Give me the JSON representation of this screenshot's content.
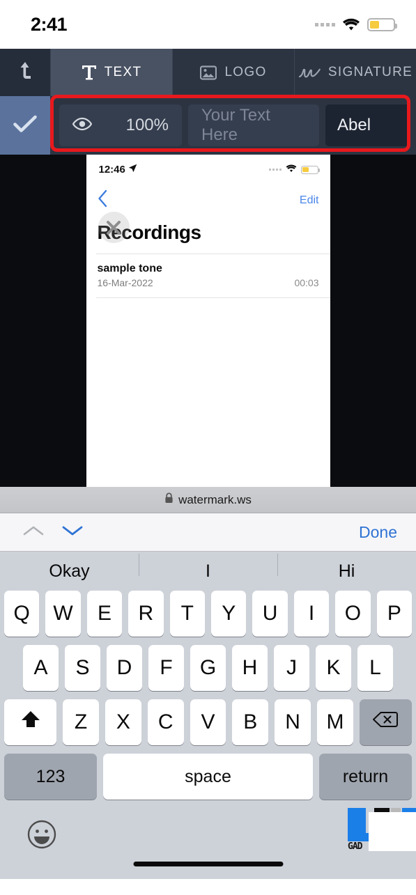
{
  "status_bar": {
    "time": "2:41",
    "wifi_icon": "wifi-icon",
    "battery_icon": "battery-icon",
    "signal_dots_icon": "signal-dots-icon"
  },
  "tab_bar": {
    "upload_icon": "upload-arrow-icon",
    "tabs": [
      {
        "label": "TEXT",
        "icon": "text-t-icon",
        "active": true
      },
      {
        "label": "LOGO",
        "icon": "image-icon",
        "active": false
      },
      {
        "label": "SIGNATURE",
        "icon": "signature-scribble-icon",
        "active": false
      }
    ]
  },
  "option_bar": {
    "confirm_icon": "checkmark-icon",
    "opacity_icon": "eye-icon",
    "opacity_value": "100%",
    "text_placeholder": "Your Text Here",
    "text_value": "",
    "font_name": "Abel",
    "highlight_color": "#e8191d"
  },
  "preview": {
    "status": {
      "time": "12:46",
      "location_icon": "location-arrow-icon",
      "wifi_icon": "wifi-icon",
      "battery_icon": "battery-icon"
    },
    "nav": {
      "back_icon": "chevron-left-icon",
      "edit_label": "Edit"
    },
    "title": "Recordings",
    "close_icon": "close-x-icon",
    "recordings": [
      {
        "name": "sample tone",
        "date": "16-Mar-2022",
        "duration": "00:03"
      }
    ]
  },
  "url_bar": {
    "lock_icon": "lock-icon",
    "host": "watermark.ws"
  },
  "accessory_bar": {
    "prev_icon": "chevron-up-icon",
    "next_icon": "chevron-down-icon",
    "done_label": "Done",
    "done_color": "#2f73d4"
  },
  "keyboard": {
    "suggestions": [
      "Okay",
      "I",
      "Hi"
    ],
    "row1": [
      "Q",
      "W",
      "E",
      "R",
      "T",
      "Y",
      "U",
      "I",
      "O",
      "P"
    ],
    "row2": [
      "A",
      "S",
      "D",
      "F",
      "G",
      "H",
      "J",
      "K",
      "L"
    ],
    "row3": [
      "Z",
      "X",
      "C",
      "V",
      "B",
      "N",
      "M"
    ],
    "shift_icon": "shift-arrow-icon",
    "backspace_icon": "backspace-icon",
    "numbers_label": "123",
    "space_label": "space",
    "return_label": "return",
    "emoji_icon": "emoji-smiley-icon",
    "home_indicator_icon": "home-indicator"
  },
  "watermark_logo": {
    "text": "GAD"
  }
}
